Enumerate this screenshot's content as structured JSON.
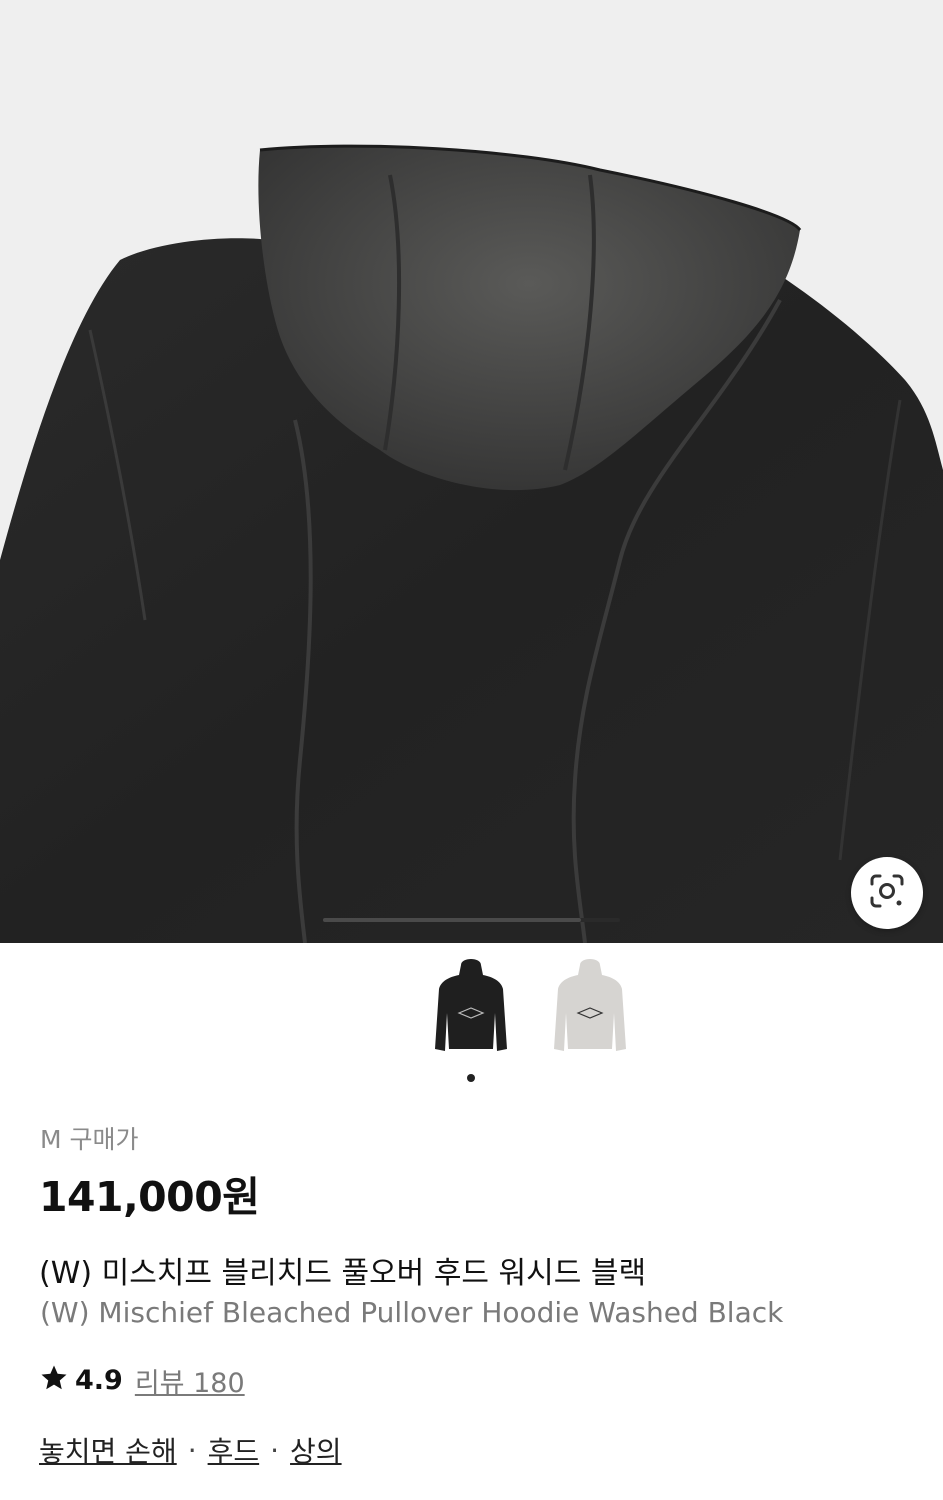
{
  "product": {
    "size_label": "M 구매가",
    "price": "141,000원",
    "title_ko": "(W) 미스치프 블리치드 풀오버 후드 워시드 블랙",
    "title_en": "(W) Mischief Bleached Pullover Hoodie Washed Black"
  },
  "gallery": {
    "progress_fraction": 0.87,
    "lens_icon": "lens-search-icon",
    "thumbnails": [
      {
        "color": "black",
        "selected": true
      },
      {
        "color": "washed-grey",
        "selected": false
      }
    ]
  },
  "rating": {
    "score": "4.9",
    "reviews_label": "리뷰 180",
    "star_icon": "star-icon"
  },
  "tags": [
    {
      "label": "놓치면 손해"
    },
    {
      "label": "후드"
    },
    {
      "label": "상의"
    }
  ],
  "tag_separator": "·",
  "colors": {
    "price": "#111111",
    "muted": "#8a8a8a",
    "hoodie": "#232323"
  }
}
